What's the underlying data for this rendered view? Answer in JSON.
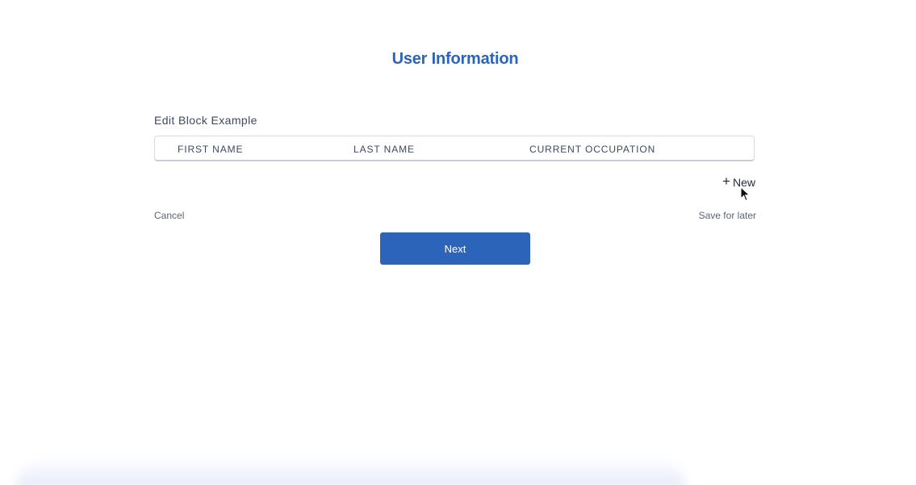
{
  "page": {
    "title": "User Information"
  },
  "edit_block": {
    "label": "Edit Block Example",
    "columns": [
      "FIRST NAME",
      "LAST NAME",
      "CURRENT OCCUPATION"
    ],
    "new_label": "New",
    "new_icon": "plus-icon"
  },
  "footer": {
    "cancel_label": "Cancel",
    "save_for_later_label": "Save for later",
    "next_label": "Next"
  },
  "colors": {
    "accent": "#2b64b8",
    "text": "#3e4a5c"
  }
}
